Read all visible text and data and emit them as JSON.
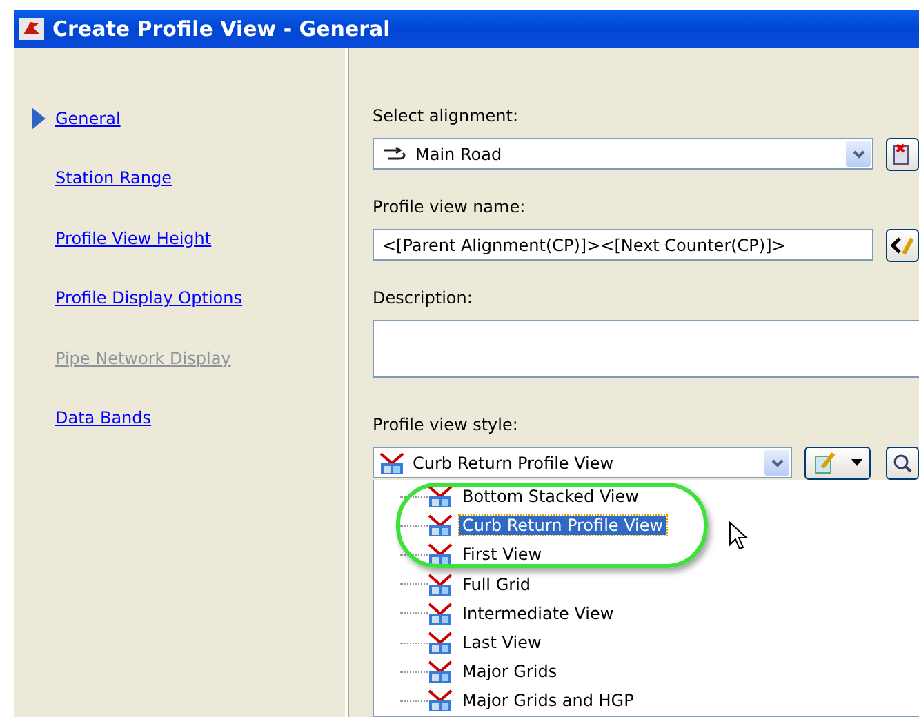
{
  "window": {
    "title": "Create Profile View - General"
  },
  "nav": [
    {
      "label": "General",
      "selected": true,
      "disabled": false
    },
    {
      "label": "Station Range",
      "selected": false,
      "disabled": false
    },
    {
      "label": "Profile View Height",
      "selected": false,
      "disabled": false
    },
    {
      "label": "Profile Display Options",
      "selected": false,
      "disabled": false
    },
    {
      "label": "Pipe Network Display",
      "selected": false,
      "disabled": true
    },
    {
      "label": "Data Bands",
      "selected": false,
      "disabled": false
    }
  ],
  "alignment": {
    "label": "Select alignment:",
    "value": "Main Road"
  },
  "name": {
    "label": "Profile view name:",
    "value": "<[Parent Alignment(CP)]><[Next Counter(CP)]>"
  },
  "description": {
    "label": "Description:"
  },
  "style": {
    "label": "Profile view style:",
    "value": "Curb Return Profile View",
    "options": [
      {
        "label": "Bottom Stacked View",
        "selected": false
      },
      {
        "label": "Curb Return Profile View",
        "selected": true
      },
      {
        "label": "First View",
        "selected": false
      },
      {
        "label": "Full Grid",
        "selected": false
      },
      {
        "label": "Intermediate View",
        "selected": false
      },
      {
        "label": "Last View",
        "selected": false
      },
      {
        "label": "Major Grids",
        "selected": false
      },
      {
        "label": "Major Grids and HGP",
        "selected": false
      }
    ]
  }
}
